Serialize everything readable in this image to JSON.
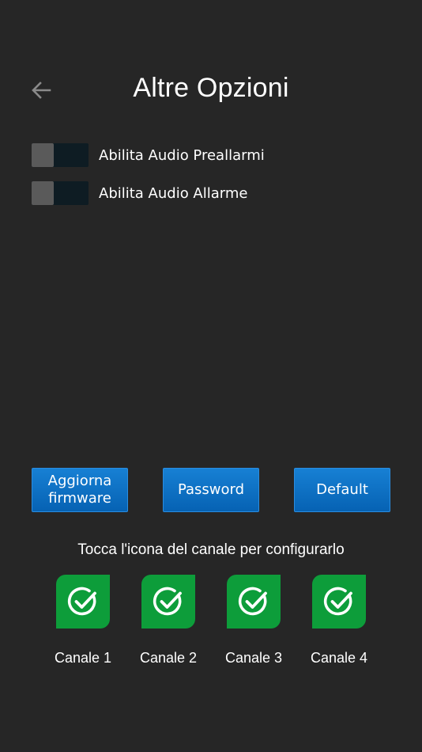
{
  "header": {
    "title": "Altre Opzioni",
    "back_icon": "arrow-left-icon"
  },
  "toggles": [
    {
      "label": "Abilita Audio Preallarmi",
      "enabled": false
    },
    {
      "label": "Abilita Audio Allarme",
      "enabled": false
    }
  ],
  "buttons": {
    "firmware_label": "Aggiorna\nfirmware",
    "password_label": "Password",
    "default_label": "Default"
  },
  "channels": {
    "hint": "Tocca l'icona del canale per configurarlo",
    "icon": "check-circle-icon",
    "accent_color": "#0d9d3a",
    "items": [
      {
        "label": "Canale 1"
      },
      {
        "label": "Canale 2"
      },
      {
        "label": "Canale 3"
      },
      {
        "label": "Canale 4"
      }
    ]
  },
  "colors": {
    "background": "#262626",
    "button": "#0a6ec4"
  }
}
